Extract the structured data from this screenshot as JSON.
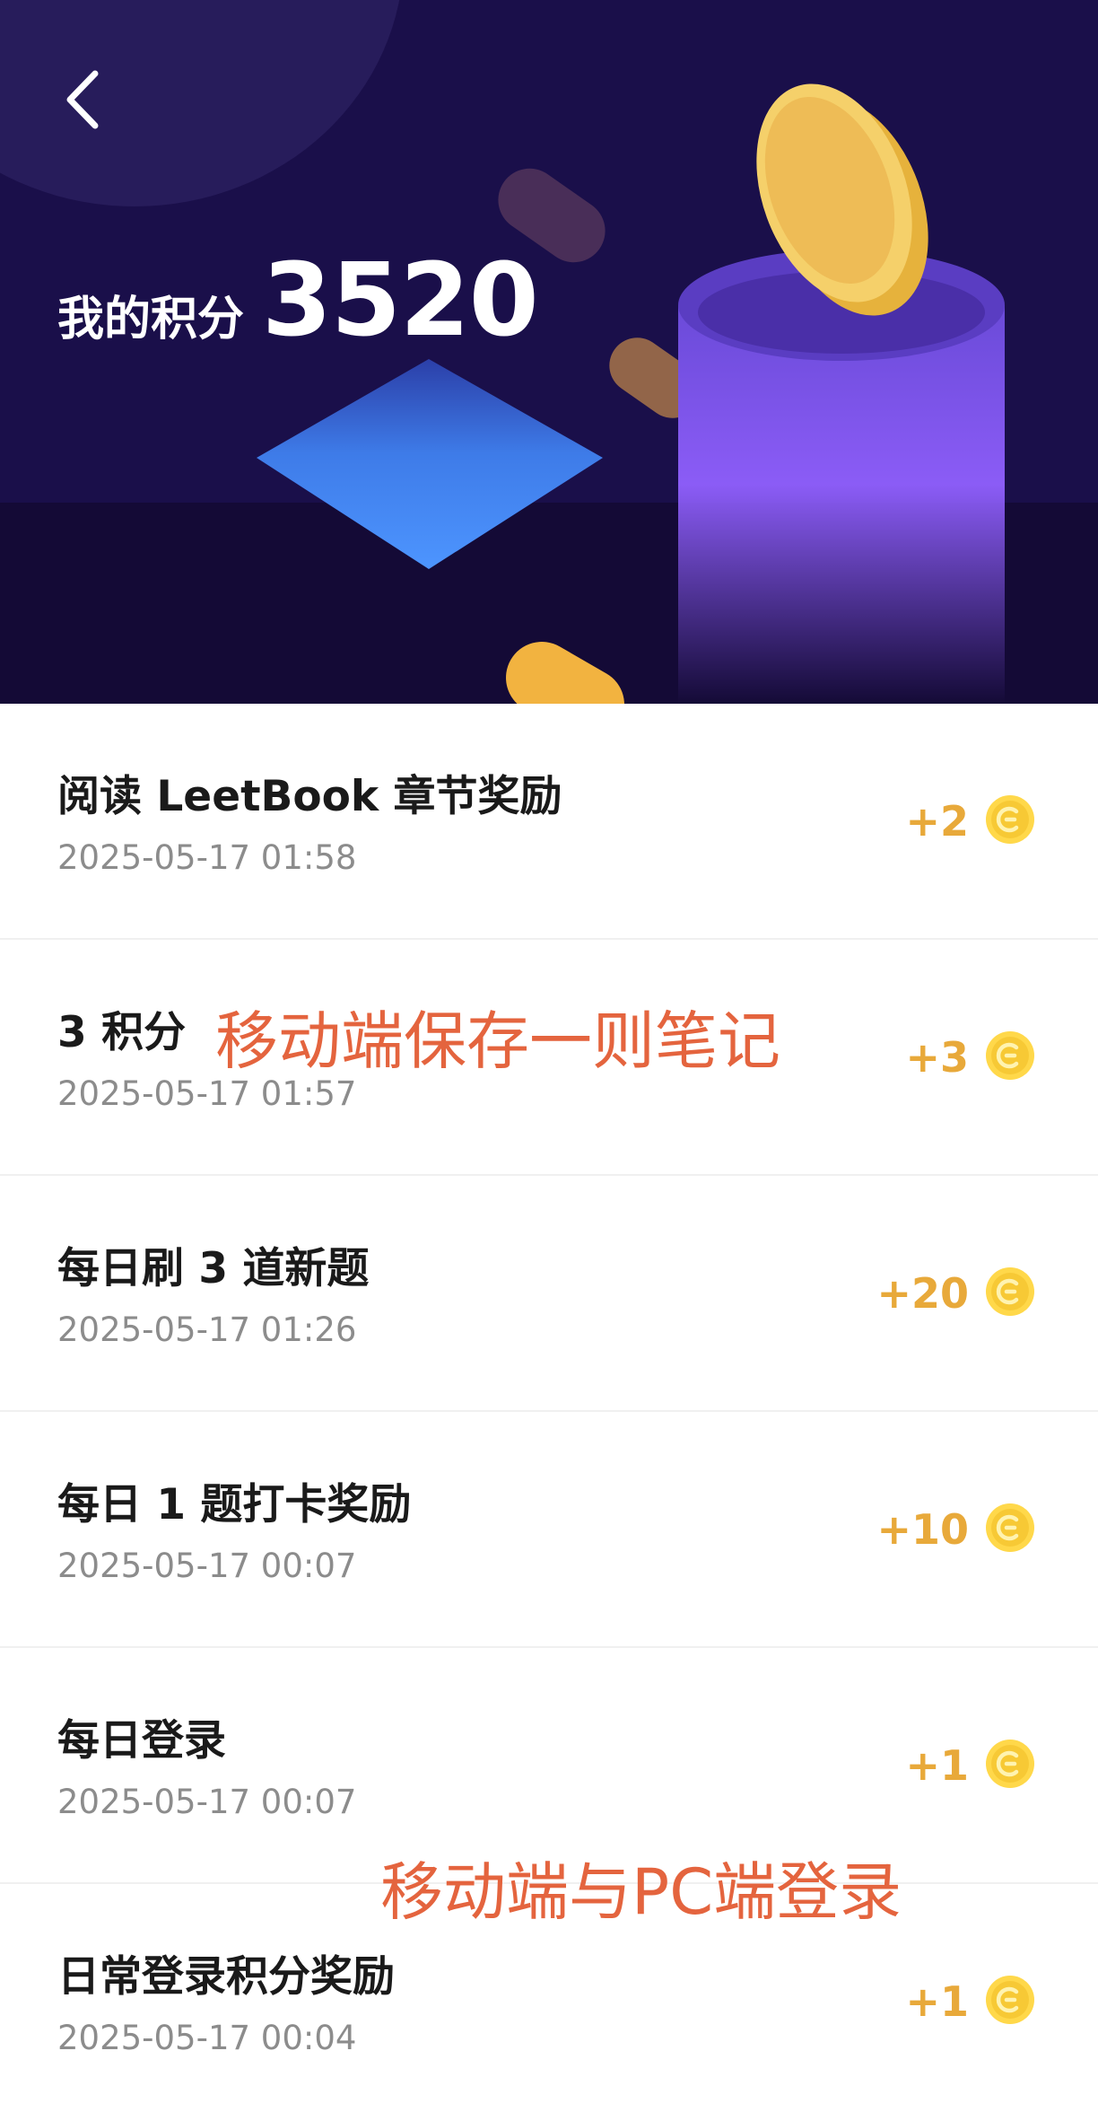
{
  "header": {
    "title_label": "我的积分",
    "points_total": "3520"
  },
  "icons": {
    "back": "chevron-left-icon",
    "coin": "coin-icon"
  },
  "colors": {
    "hero_bg": "#1a0f4a",
    "points": "#e8a93a",
    "annotation": "#e4643e"
  },
  "records": [
    {
      "title": "阅读 LeetBook 章节奖励",
      "time": "2025-05-17 01:58",
      "points": "+2"
    },
    {
      "title": "3 积分",
      "time": "2025-05-17 01:57",
      "points": "+3"
    },
    {
      "title": "每日刷 3 道新题",
      "time": "2025-05-17 01:26",
      "points": "+20"
    },
    {
      "title": "每日 1 题打卡奖励",
      "time": "2025-05-17 00:07",
      "points": "+10"
    },
    {
      "title": "每日登录",
      "time": "2025-05-17 00:07",
      "points": "+1"
    },
    {
      "title": "日常登录积分奖励",
      "time": "2025-05-17 00:04",
      "points": "+1"
    }
  ],
  "annotations": [
    "移动端保存一则笔记",
    "移动端与PC端登录"
  ]
}
